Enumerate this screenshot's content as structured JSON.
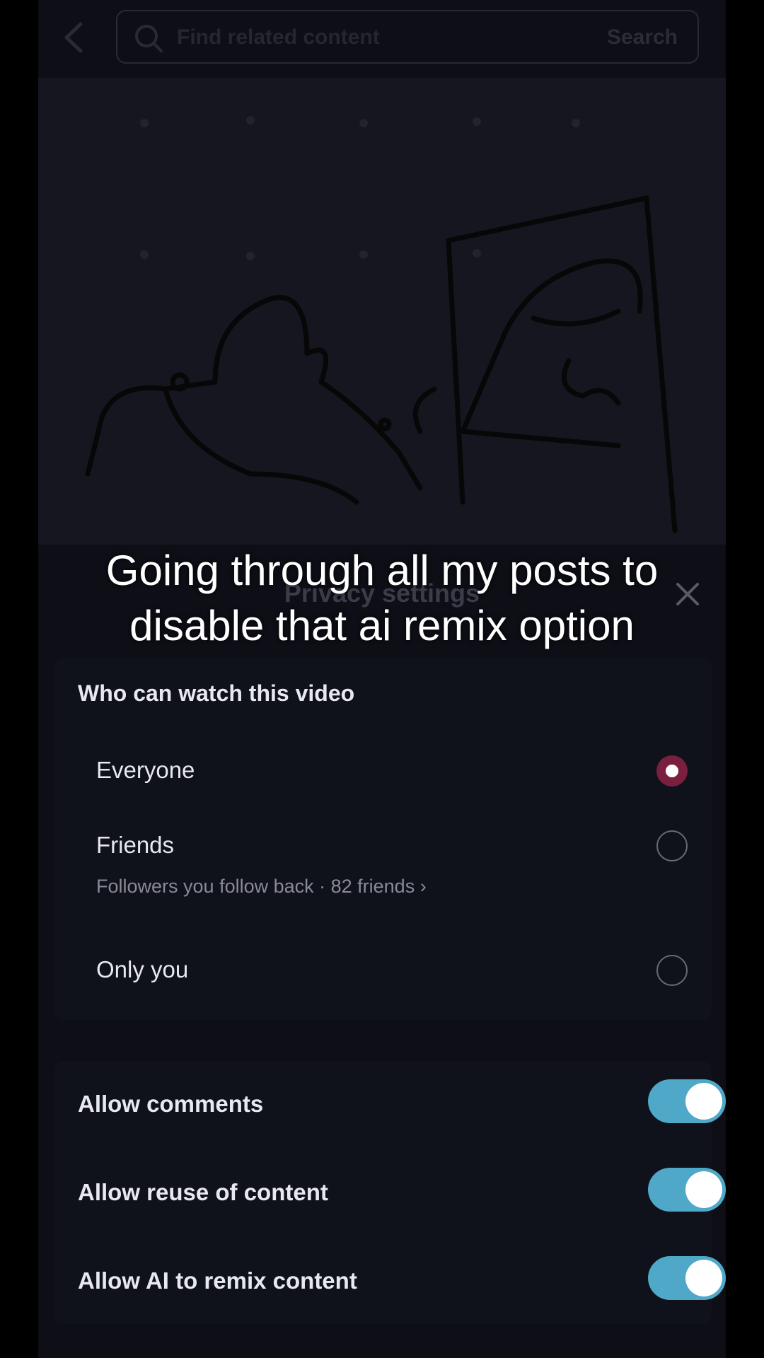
{
  "topbar": {
    "search_placeholder": "Find related content",
    "search_button": "Search"
  },
  "caption": {
    "line1": "Going through all my posts to",
    "line2": "disable that ai remix option"
  },
  "sheet": {
    "title": "Privacy settings",
    "watch_heading": "Who can watch this video",
    "options": [
      {
        "label": "Everyone",
        "selected": true
      },
      {
        "label": "Friends",
        "sublabel": "Followers you follow back · 82 friends",
        "selected": false
      },
      {
        "label": "Only you",
        "selected": false
      }
    ],
    "toggles": [
      {
        "label": "Allow comments",
        "on": true
      },
      {
        "label": "Allow reuse of content",
        "on": true
      },
      {
        "label": "Allow AI to remix content",
        "on": true
      }
    ]
  },
  "colors": {
    "accent_toggle": "#4fa8c7",
    "radio_selected": "#7a1f3d",
    "background": "#0d0e16"
  }
}
